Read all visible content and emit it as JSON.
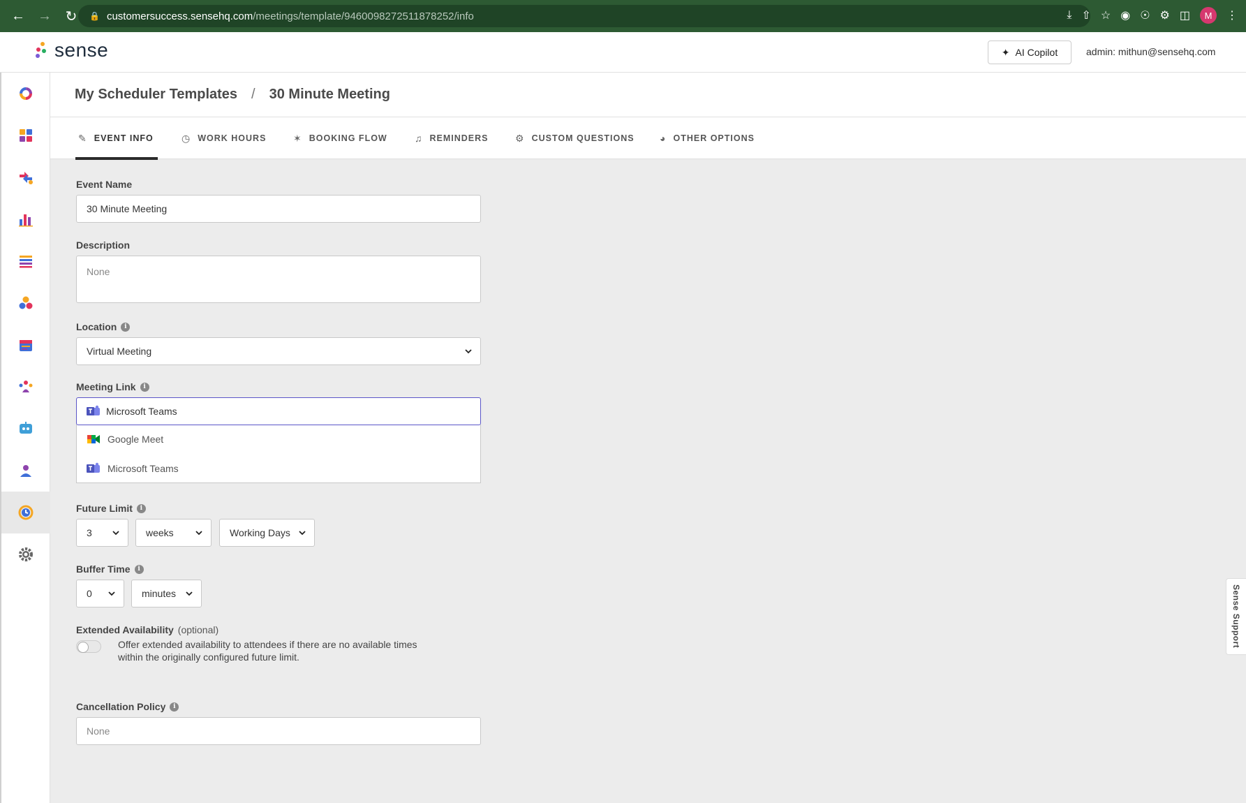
{
  "browser": {
    "url_host": "customersuccess.sensehq.com",
    "url_path": "/meetings/template/9460098272511878252/info",
    "profile_initial": "M"
  },
  "header": {
    "logo_text": "sense",
    "copilot_label": "AI Copilot",
    "admin_label": "admin: mithun@sensehq.com"
  },
  "breadcrumb": {
    "parent": "My Scheduler Templates",
    "separator": "/",
    "current": "30 Minute Meeting"
  },
  "tabs": [
    {
      "label": "EVENT INFO",
      "icon": "pencil-icon"
    },
    {
      "label": "WORK HOURS",
      "icon": "clock-icon"
    },
    {
      "label": "BOOKING FLOW",
      "icon": "flow-icon"
    },
    {
      "label": "REMINDERS",
      "icon": "bell-icon"
    },
    {
      "label": "CUSTOM QUESTIONS",
      "icon": "gear-icon"
    },
    {
      "label": "OTHER OPTIONS",
      "icon": "palette-icon"
    }
  ],
  "form": {
    "event_name_label": "Event Name",
    "event_name_value": "30 Minute Meeting",
    "description_label": "Description",
    "description_placeholder": "None",
    "location_label": "Location",
    "location_value": "Virtual Meeting",
    "meeting_link_label": "Meeting Link",
    "meeting_link_value": "Microsoft Teams",
    "meeting_link_options": [
      "Google Meet",
      "Microsoft Teams"
    ],
    "future_limit_label": "Future Limit",
    "future_limit_number": "3",
    "future_limit_unit": "weeks",
    "future_limit_type": "Working Days",
    "buffer_time_label": "Buffer Time",
    "buffer_time_number": "0",
    "buffer_time_unit": "minutes",
    "extended_label": "Extended Availability",
    "extended_optional": "(optional)",
    "extended_desc": "Offer extended availability to attendees if there are no available times within the originally configured future limit.",
    "cancellation_label": "Cancellation Policy",
    "cancellation_placeholder": "None"
  },
  "support_label": "Sense Support",
  "colors": {
    "browser_bar": "#2d5a33",
    "focus_border": "#5a55c8",
    "teams_purple": "#5059c9"
  }
}
